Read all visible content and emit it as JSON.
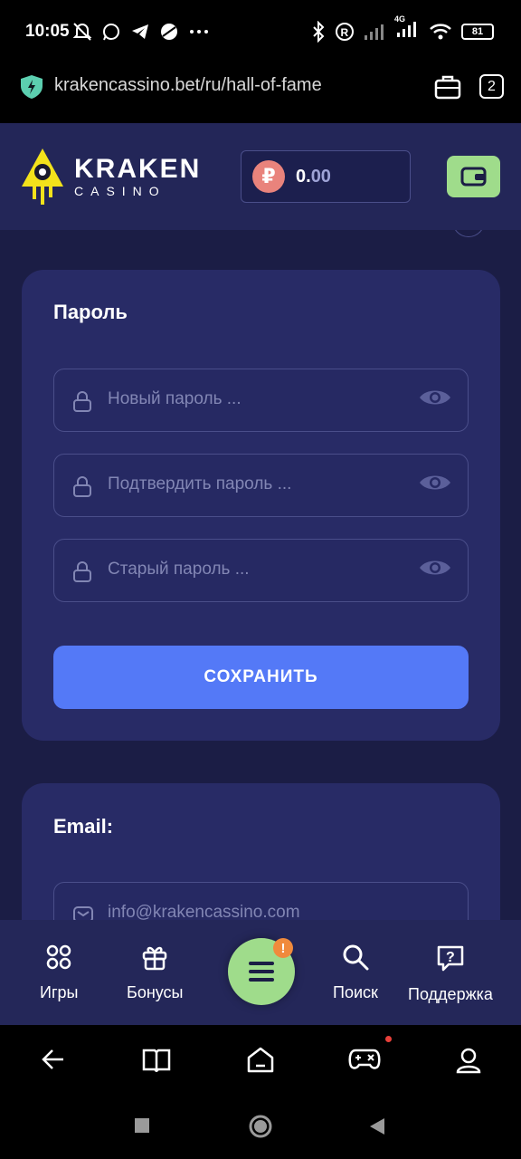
{
  "status_bar": {
    "time": "10:05",
    "network": "4G",
    "battery": "81"
  },
  "browser": {
    "url": "krakencassino.bet/ru/hall-of-fame",
    "tab_count": "2"
  },
  "header": {
    "logo_main": "KRAKEN",
    "logo_sub": "CASINO",
    "currency_symbol": "₽",
    "balance_int": "0.",
    "balance_dec": "00"
  },
  "password_card": {
    "title": "Пароль",
    "new_password_placeholder": "Новый пароль ...",
    "confirm_password_placeholder": "Подтвердить пароль ...",
    "old_password_placeholder": "Старый пароль ...",
    "save_label": "СОХРАНИТЬ"
  },
  "email_card": {
    "title": "Email:",
    "email_value": "info@krakencassino.com"
  },
  "bottom_nav": {
    "menu_badge": "!",
    "items": [
      {
        "label": "Игры",
        "icon": "grid-icon"
      },
      {
        "label": "Бонусы",
        "icon": "gift-icon"
      },
      {
        "label": "Поиск",
        "icon": "search-icon"
      },
      {
        "label": "Поддержка",
        "icon": "support-icon"
      }
    ]
  },
  "colors": {
    "header_bg": "#232658",
    "content_bg": "#1b1d45",
    "card_bg": "#282b66",
    "primary_button": "#5479f7",
    "accent_green": "#9fdc8b",
    "coin": "#e9837c"
  }
}
